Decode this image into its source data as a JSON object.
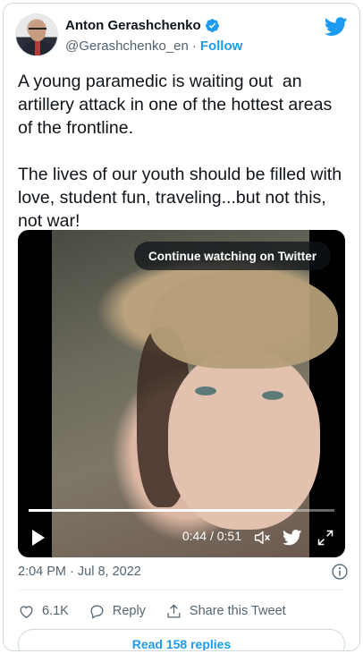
{
  "author": {
    "name": "Anton Gerashchenko",
    "handle": "@Gerashchenko_en",
    "separator": "·",
    "follow_label": "Follow"
  },
  "tweet": {
    "text": "A young paramedic is waiting out  an artillery attack in one of the hottest areas of the frontline.\n\nThe lives of our youth should be filled with love, student fun, traveling...but not this, not war!"
  },
  "video": {
    "continue_label": "Continue watching on Twitter",
    "time_display": "0:44 / 0:51",
    "progress_fraction": 0.863
  },
  "footer": {
    "timestamp": "2:04 PM · Jul 8, 2022",
    "like_count": "6.1K",
    "reply_label": "Reply",
    "share_label": "Share this Tweet",
    "read_replies_label": "Read 158 replies"
  },
  "colors": {
    "accent": "#1d9bf0",
    "secondary_text": "#536471",
    "border": "#cfd9de"
  },
  "icons": [
    "verified-badge-icon",
    "twitter-bird-icon",
    "play-icon",
    "volume-icon",
    "twitter-bird-small-icon",
    "fullscreen-icon",
    "info-icon",
    "heart-icon",
    "reply-icon",
    "share-icon"
  ]
}
